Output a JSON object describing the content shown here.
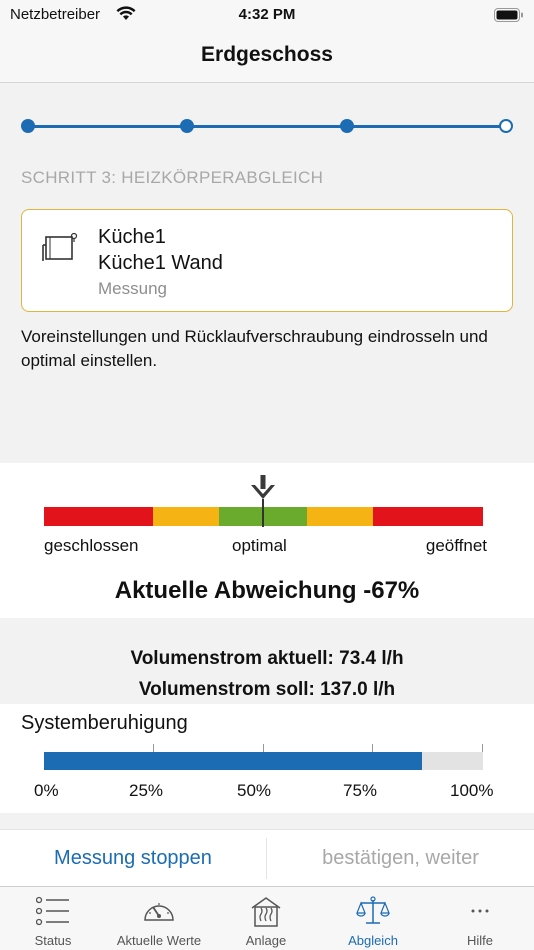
{
  "status_bar": {
    "carrier": "Netzbetreiber",
    "time": "4:32 PM"
  },
  "nav": {
    "title": "Erdgeschoss"
  },
  "stepper": {
    "total_steps": 4,
    "current_step": 3
  },
  "step_label": "SCHRITT 3: HEIZKÖRPERABGLEICH",
  "card": {
    "room": "Küche1",
    "radiator": "Küche1 Wand",
    "mode": "Messung",
    "icon": "radiator-icon"
  },
  "instruction": "Voreinstellungen und Rücklaufverschraubung eindrosseln und optimal einstellen.",
  "gauge": {
    "label_left": "geschlossen",
    "label_center": "optimal",
    "label_right": "geöffnet",
    "deviation_text": "Aktuelle Abweichung -67%",
    "colors": {
      "red": "#e2131b",
      "yellow": "#f5b413",
      "green": "#6aaa2c"
    }
  },
  "flow": {
    "current": "Volumenstrom aktuell: 73.4 l/h",
    "target": "Volumenstrom soll: 137.0 l/h"
  },
  "system_calm": {
    "title": "Systemberuhigung",
    "progress": 0.86,
    "ticks": [
      "0%",
      "25%",
      "50%",
      "75%",
      "100%"
    ]
  },
  "actions": {
    "stop": "Messung stoppen",
    "next": "bestätigen, weiter"
  },
  "tabs": [
    {
      "label": "Status",
      "icon": "list-icon",
      "active": false
    },
    {
      "label": "Aktuelle Werte",
      "icon": "gauge-icon",
      "active": false
    },
    {
      "label": "Anlage",
      "icon": "boiler-icon",
      "active": false
    },
    {
      "label": "Abgleich",
      "icon": "balance-icon",
      "active": true
    },
    {
      "label": "Hilfe",
      "icon": "more-icon",
      "active": false
    }
  ],
  "accent_color": "#1c6cb4"
}
